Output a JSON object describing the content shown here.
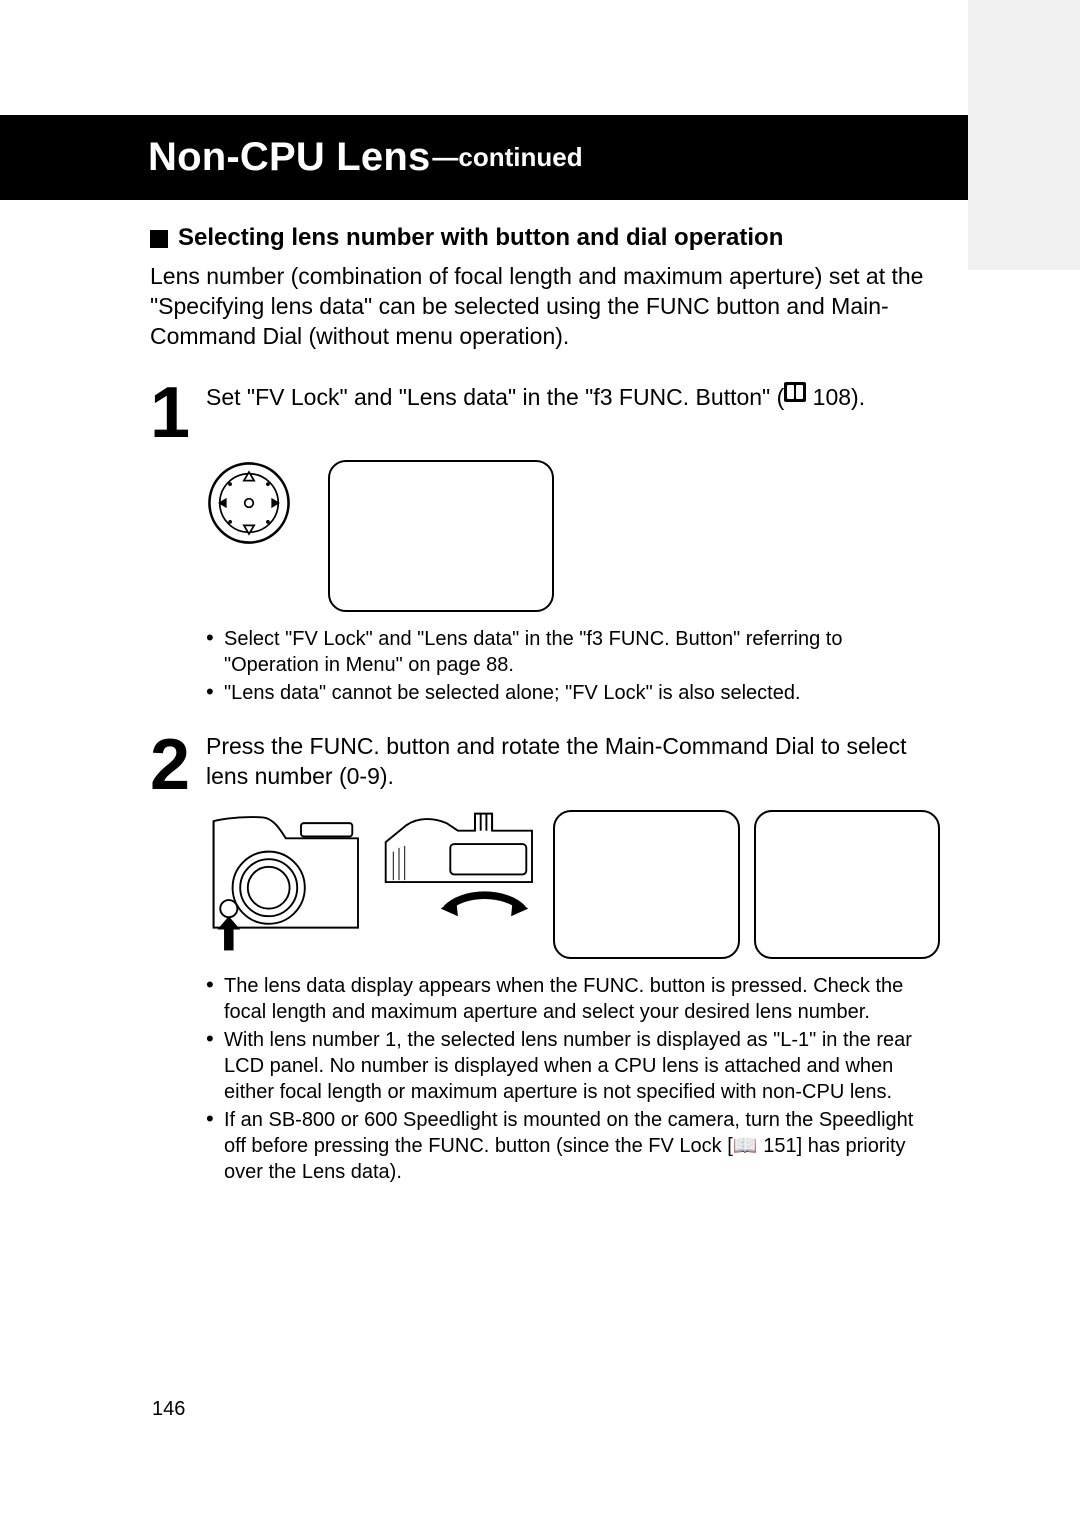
{
  "banner": {
    "title_main": "Non-CPU Lens",
    "title_sub": "—continued"
  },
  "section": {
    "heading": "Selecting lens number with button and dial operation",
    "intro": "Lens number (combination of focal length and maximum aperture) set at the \"Specifying lens data\" can be selected using the FUNC button and Main-Command Dial (without menu operation)."
  },
  "step1": {
    "number": "1",
    "text_before_icon": "Set \"FV Lock\" and \"Lens data\" in the \"f3 FUNC. Button\" (",
    "ref_page": " 108).",
    "notes": [
      "Select \"FV Lock\" and \"Lens data\" in the \"f3 FUNC. Button\" referring to \"Operation in Menu\" on page 88.",
      "\"Lens data\" cannot be selected alone; \"FV Lock\" is also selected."
    ]
  },
  "step2": {
    "number": "2",
    "text": "Press the FUNC. button and rotate the Main-Command Dial to select lens number (0-9).",
    "notes": [
      "The lens data display appears when the FUNC. button is pressed. Check the focal length and maximum aperture and select your desired lens number.",
      "With lens number 1, the selected lens number is displayed as \"L-1\" in the rear LCD panel. No number is displayed when a CPU lens is attached and when either focal length or maximum aperture is not specified with non-CPU lens.",
      "If an SB-800 or 600 Speedlight is mounted on the camera, turn the Speedlight off before pressing the FUNC. button (since the FV Lock [📖 151] has priority over the Lens data)."
    ]
  },
  "page_number": "146",
  "icons": {
    "dial": "multi-selector-dial-icon",
    "camera_left": "camera-func-button-press-icon",
    "camera_right": "camera-command-dial-rotate-icon",
    "page_ref": "page-reference-icon"
  }
}
